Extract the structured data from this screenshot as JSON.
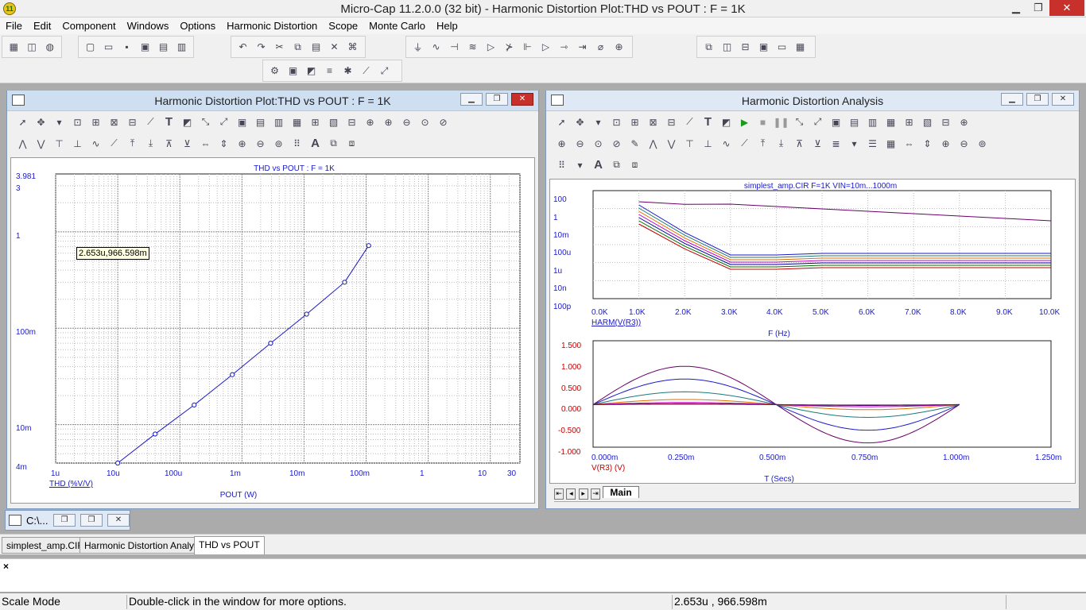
{
  "app": {
    "title": "Micro-Cap 11.2.0.0 (32 bit) - Harmonic Distortion Plot:THD vs POUT : F = 1K",
    "icon_text": "11"
  },
  "window_controls": {
    "minimize": "▁",
    "restore": "❐",
    "close": "✕"
  },
  "menu": [
    "File",
    "Edit",
    "Component",
    "Windows",
    "Options",
    "Harmonic Distortion",
    "Scope",
    "Monte Carlo",
    "Help"
  ],
  "left_window": {
    "title": "Harmonic Distortion Plot:THD vs POUT : F = 1K",
    "chart_title": "THD vs POUT : F = 1K",
    "tooltip": "2.653u,966.598m",
    "y_ticks": [
      "3.981",
      "3",
      "1",
      "100m",
      "10m",
      "4m"
    ],
    "x_ticks": [
      "1u",
      "10u",
      "100u",
      "1m",
      "10m",
      "100m",
      "1",
      "10",
      "30"
    ],
    "y_label": "THD (%V/V)",
    "x_label": "POUT (W)"
  },
  "right_window": {
    "title": "Harmonic Distortion Analysis",
    "top_chart_title": "simplest_amp.CIR F=1K VIN=10m...1000m",
    "top_y_ticks": [
      "100",
      "1",
      "10m",
      "100u",
      "1u",
      "10n",
      "100p"
    ],
    "top_x_ticks": [
      "0.0K",
      "1.0K",
      "2.0K",
      "3.0K",
      "4.0K",
      "5.0K",
      "6.0K",
      "7.0K",
      "8.0K",
      "9.0K",
      "10.0K"
    ],
    "top_y_label": "HARM(V(R3))",
    "top_x_label": "F (Hz)",
    "bottom_y_ticks": [
      "1.500",
      "1.000",
      "0.500",
      "0.000",
      "-0.500",
      "-1.000"
    ],
    "bottom_x_ticks": [
      "0.000m",
      "0.250m",
      "0.500m",
      "0.750m",
      "1.000m",
      "1.250m"
    ],
    "bottom_y_label": "V(R3) (V)",
    "bottom_x_label": "T (Secs)",
    "page_tab": "Main"
  },
  "minimized_window": {
    "title": "C:\\..."
  },
  "doc_tabs": [
    "simplest_amp.CIR",
    "Harmonic Distortion Analysis",
    "THD vs POUT"
  ],
  "output_close": "×",
  "status": {
    "mode": "Scale Mode",
    "hint": "Double-click in the window for more options.",
    "coords": "2.653u , 966.598m"
  },
  "chart_data": [
    {
      "type": "line",
      "title": "THD vs POUT : F = 1K",
      "xlabel": "POUT (W)",
      "ylabel": "THD (%V/V)",
      "x_scale": "log",
      "y_scale": "log",
      "xlim": [
        "1u",
        "30"
      ],
      "ylim": [
        "4m",
        "3.981"
      ],
      "series": [
        {
          "values_xy": [
            [
              "10u",
              "4m"
            ],
            [
              "40u",
              "8m"
            ],
            [
              "170u",
              "16m"
            ],
            [
              "700u",
              "33m"
            ],
            [
              "2.9m",
              "70m"
            ],
            [
              "11m",
              "140m"
            ],
            [
              "45m",
              "300m"
            ],
            [
              "110m",
              "720m"
            ]
          ]
        }
      ]
    },
    {
      "type": "line",
      "title": "simplest_amp.CIR F=1K VIN=10m...1000m",
      "xlabel": "F (Hz)",
      "ylabel": "HARM(V(R3))",
      "x_scale": "linear",
      "y_scale": "log",
      "xlim": [
        "0.0K",
        "10.0K"
      ],
      "ylim": [
        "100p",
        "100"
      ]
    },
    {
      "type": "line",
      "xlabel": "T (Secs)",
      "ylabel": "V(R3) (V)",
      "xlim": [
        "0.000m",
        "1.250m"
      ],
      "ylim": [
        "-1.000",
        "1.500"
      ],
      "series_amplitudes": [
        0.9,
        0.6,
        0.3,
        0.12,
        0.05,
        0.02,
        0.01
      ]
    }
  ],
  "colors": {
    "axis_text": "#1a1ac8",
    "plot_line": "#1a1ac8",
    "close_red": "#c7302b"
  }
}
